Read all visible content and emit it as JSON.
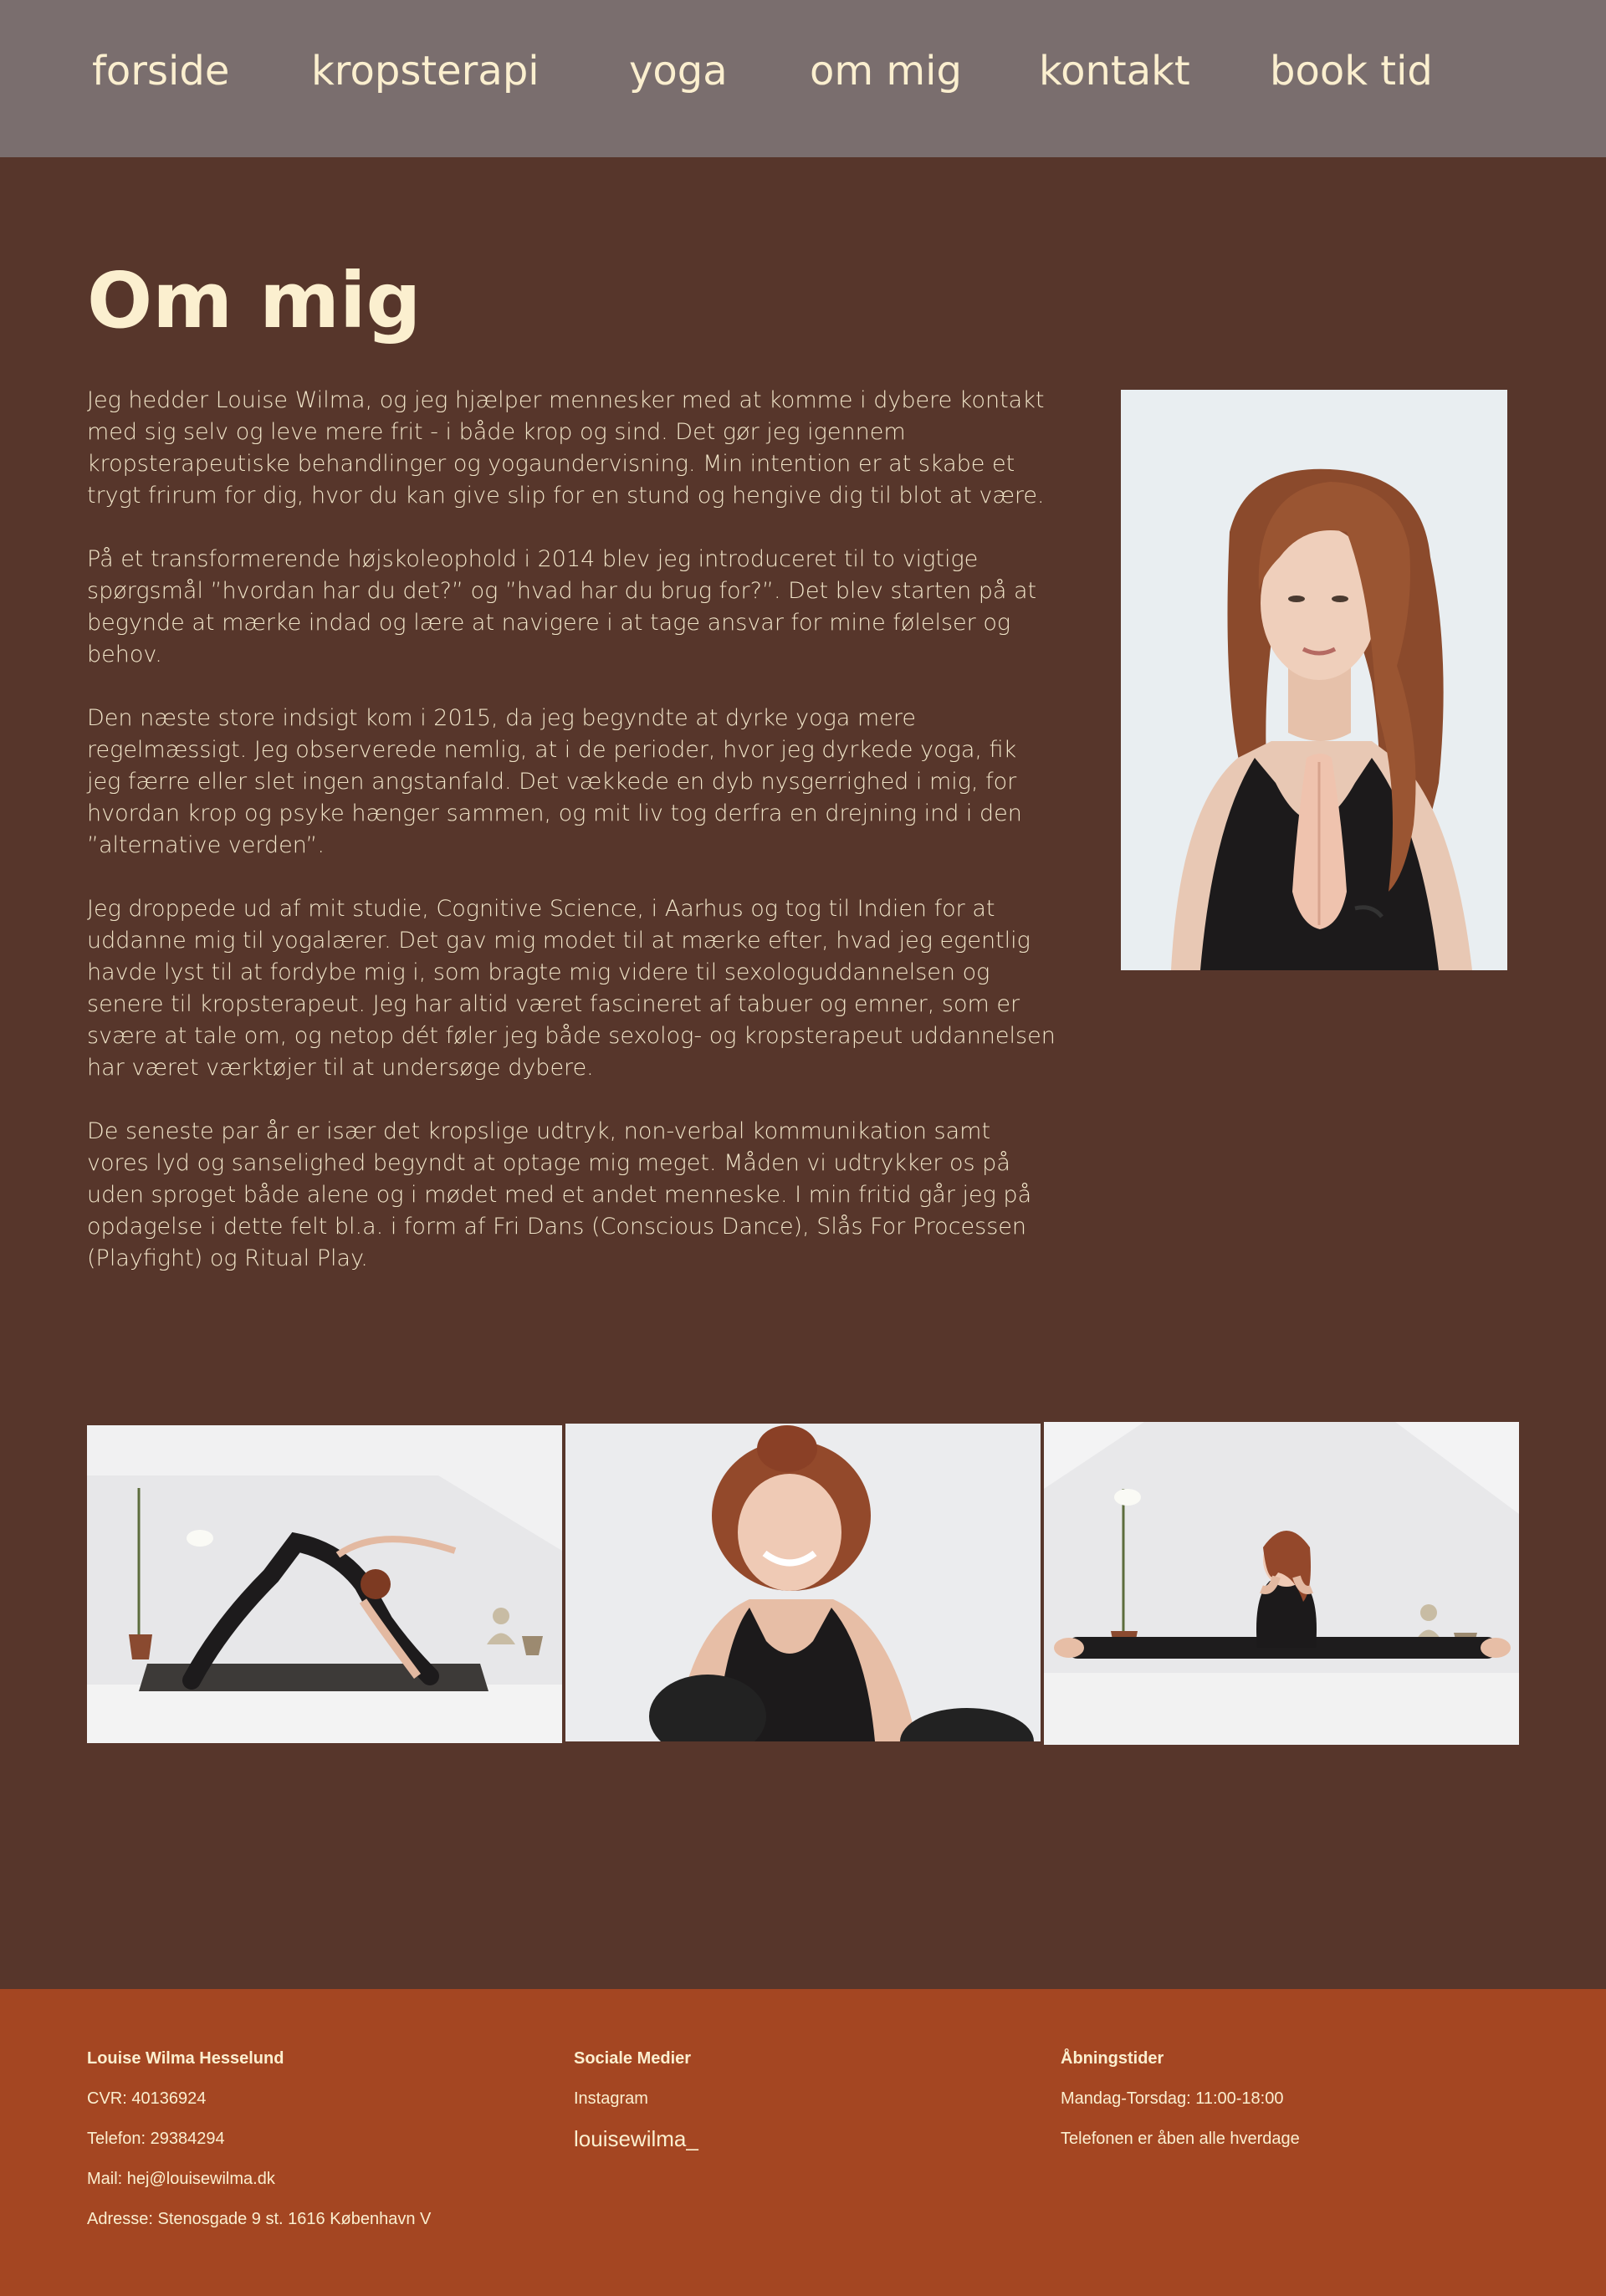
{
  "nav": {
    "items": [
      {
        "label": "forside"
      },
      {
        "label": "kropsterapi"
      },
      {
        "label": "yoga"
      },
      {
        "label": "om mig"
      },
      {
        "label": "kontakt"
      },
      {
        "label": "book tid"
      }
    ]
  },
  "main": {
    "title": "Om mig",
    "paragraphs": [
      "Jeg hedder Louise Wilma, og jeg hjælper mennesker med at komme i dybere kontakt med sig selv og leve mere frit - i både krop og sind. Det gør jeg igennem kropsterapeutiske behandlinger og yogaundervisning. Min intention er at skabe et trygt frirum for dig, hvor du kan give slip for en stund og hengive dig til blot at være.",
      "På et transformerende højskoleophold i 2014 blev jeg introduceret til to vigtige spørgsmål ”hvordan har du det?” og ”hvad har du brug for?”. Det blev starten på at begynde at mærke indad og lære at navigere i at tage ansvar for mine følelser og behov.",
      "Den næste store indsigt kom i 2015, da jeg begyndte at dyrke yoga mere regelmæssigt. Jeg observerede nemlig, at i de perioder, hvor jeg dyrkede yoga, fik jeg færre eller slet ingen angstanfald. Det vækkede en dyb nysgerrighed i mig, for hvordan krop og psyke hænger sammen, og mit liv tog derfra en drejning ind i den ”alternative verden”.",
      "Jeg droppede ud af mit studie, Cognitive Science, i Aarhus og tog til Indien for at uddanne mig til yogalærer. Det gav mig modet til at mærke efter, hvad jeg egentlig havde lyst til at fordybe mig i, som bragte mig videre til sexologuddannelsen og senere til kropsterapeut. Jeg har altid været fascineret af tabuer og emner, som er svære at tale om, og netop dét føler jeg både sexolog- og kropsterapeut uddannelsen har været værktøjer til at undersøge dybere.",
      "De seneste par år er især det kropslige udtryk, non-verbal kommunikation samt vores lyd og sanselighed begyndt at optage mig meget. Måden vi udtrykker os på uden sproget både alene og i mødet med et andet menneske. I min fritid går jeg på opdagelse i dette felt bl.a. i form af Fri Dans (Conscious Dance), Slås For Processen (Playfight) og Ritual Play."
    ]
  },
  "footer": {
    "col1": {
      "heading": "Louise Wilma Hesselund",
      "cvr": "CVR: 40136924",
      "phone": "Telefon: 29384294",
      "mail": "Mail: hej@louisewilma.dk",
      "address": "Adresse: Stenosgade 9 st. 1616 København V"
    },
    "col2": {
      "heading": "Sociale Medier",
      "instagram": "Instagram",
      "handle": "louisewilma_"
    },
    "col3": {
      "heading": "Åbningstider",
      "hours": "Mandag-Torsdag: 11:00-18:00",
      "phone_note": "Telefonen er åben alle hverdage"
    }
  },
  "colors": {
    "nav_bg": "#7a6e6e",
    "main_bg": "#57362b",
    "footer_bg": "#a44622",
    "text": "#fbefcf"
  }
}
